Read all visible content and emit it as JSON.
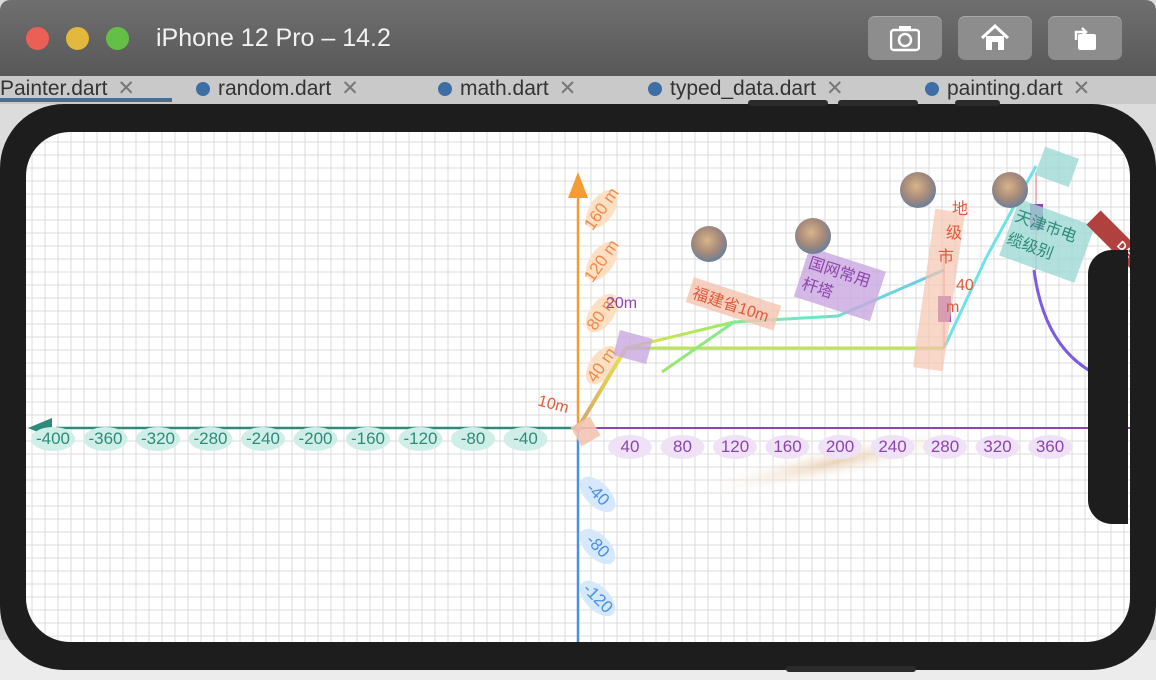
{
  "window": {
    "title": "iPhone 12 Pro – 14.2",
    "controls": {
      "screenshot_icon": "camera-icon",
      "home_icon": "home-icon",
      "rotate_icon": "rotate-icon"
    }
  },
  "ide_tabs": [
    {
      "label": "Painter.dart"
    },
    {
      "label": "random.dart"
    },
    {
      "label": "math.dart"
    },
    {
      "label": "typed_data.dart"
    },
    {
      "label": "painting.dart"
    }
  ],
  "ide_bottom_text": "),",
  "app": {
    "debug_banner": "DEBUG",
    "x_axis_negative": [
      "-400",
      "-360",
      "-320",
      "-280",
      "-240",
      "-200",
      "-160",
      "-120",
      "-80",
      "-40"
    ],
    "x_axis_positive": [
      "40",
      "80",
      "120",
      "160",
      "200",
      "240",
      "280",
      "320",
      "360"
    ],
    "y_axis_positive": [
      "40 m",
      "80 m",
      "120 m",
      "160 m"
    ],
    "y_axis_negative": [
      "-40",
      "-80",
      "-120"
    ],
    "labels": {
      "fujian": "福建省10m",
      "guowang": "国网常用杆塔",
      "dijishi": "地级市",
      "dijishi_value": "40m",
      "tianjin": "天津市电缆级别",
      "m20": "20m",
      "m10": "10m"
    },
    "colors": {
      "x_axis": "#8e44ad",
      "x_axis_neg": "#2e8b7a",
      "y_axis": "#f39c33",
      "y_axis_neg": "#4a90e2"
    }
  }
}
